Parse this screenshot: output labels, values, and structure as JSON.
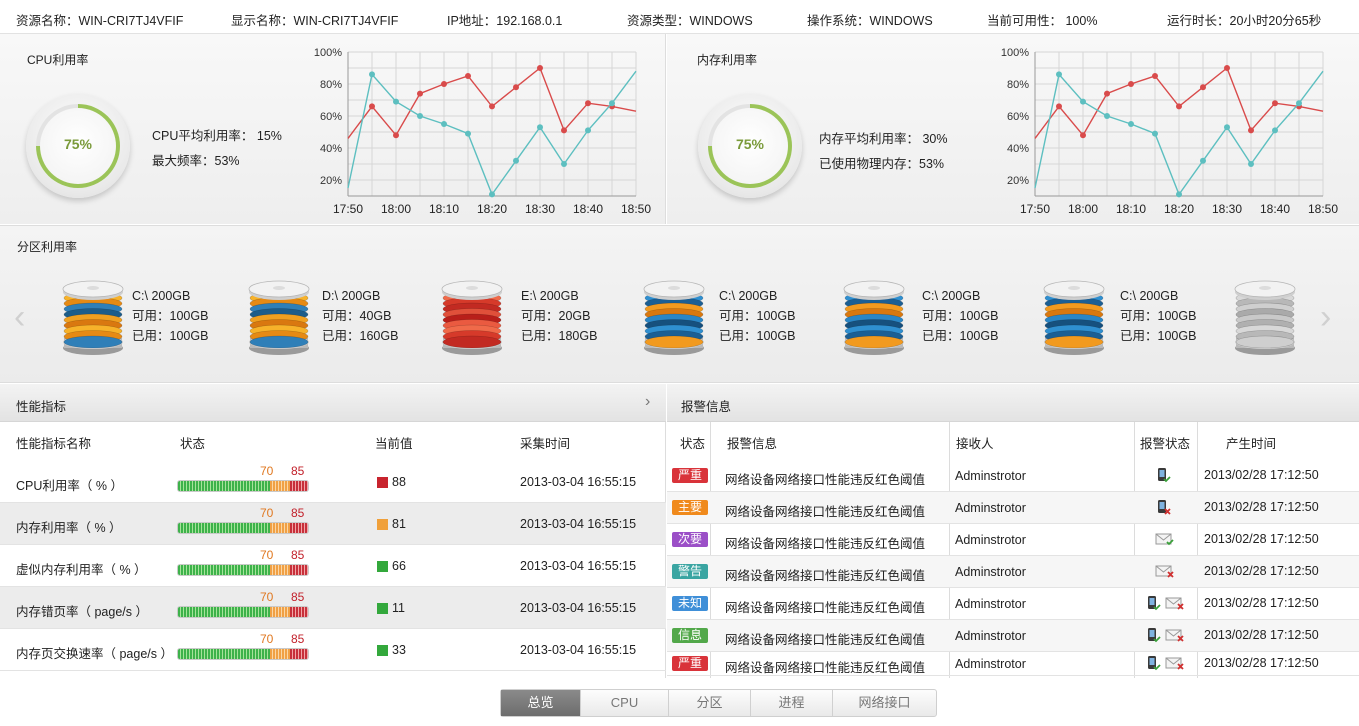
{
  "info": {
    "resource_name": "资源名称：WIN-CRI7TJ4VFIF",
    "display_name": "显示名称：WIN-CRI7TJ4VFIF",
    "ip": "IP地址：192.168.0.1",
    "resource_type": "资源类型：WINDOWS",
    "os": "操作系统：WINDOWS",
    "availability": "当前可用性： 100%",
    "uptime": "运行时长：20小时20分65秒"
  },
  "cpu": {
    "title": "CPU利用率",
    "gauge_value": "75%",
    "gauge_fraction": 0.75,
    "avg": "CPU平均利用率： 15%",
    "max_freq": "最大频率：53%"
  },
  "memory": {
    "title": "内存利用率",
    "gauge_value": "75%",
    "gauge_fraction": 0.75,
    "avg": "内存平均利用率： 30%",
    "physical": "已使用物理内存：53%"
  },
  "chart_data": [
    {
      "type": "line",
      "x": [
        "17:50",
        "17:55",
        "18:00",
        "18:05",
        "18:10",
        "18:15",
        "18:20",
        "18:25",
        "18:30",
        "18:35",
        "18:40",
        "18:45",
        "18:50"
      ],
      "x_ticks": [
        "17:50",
        "18:00",
        "18:10",
        "18:20",
        "18:30",
        "18:40",
        "18:50"
      ],
      "y_ticks": [
        "100%",
        "80%",
        "60%",
        "40%",
        "20%"
      ],
      "ylim": [
        10,
        100
      ],
      "grid": true,
      "series": [
        {
          "color": "#d94b4b",
          "values": [
            46,
            66,
            48,
            74,
            80,
            85,
            66,
            78,
            90,
            51,
            68,
            66,
            63
          ]
        },
        {
          "color": "#5dbfc0",
          "values": [
            15,
            86,
            69,
            60,
            55,
            49,
            11,
            32,
            53,
            30,
            51,
            68,
            88
          ]
        }
      ]
    },
    {
      "type": "line",
      "x": [
        "17:50",
        "17:55",
        "18:00",
        "18:05",
        "18:10",
        "18:15",
        "18:20",
        "18:25",
        "18:30",
        "18:35",
        "18:40",
        "18:45",
        "18:50"
      ],
      "x_ticks": [
        "17:50",
        "18:00",
        "18:10",
        "18:20",
        "18:30",
        "18:40",
        "18:50"
      ],
      "y_ticks": [
        "100%",
        "80%",
        "60%",
        "40%",
        "20%"
      ],
      "ylim": [
        10,
        100
      ],
      "grid": true,
      "series": [
        {
          "color": "#d94b4b",
          "values": [
            46,
            66,
            48,
            74,
            80,
            85,
            66,
            78,
            90,
            51,
            68,
            66,
            63
          ]
        },
        {
          "color": "#5dbfc0",
          "values": [
            15,
            86,
            69,
            60,
            55,
            49,
            11,
            32,
            53,
            30,
            51,
            68,
            88
          ]
        }
      ]
    }
  ],
  "partitions": {
    "title": "分区利用率",
    "items": [
      {
        "name": "C:\\ 200GB",
        "free": "可用：100GB",
        "used": "已用：100GB",
        "palette": "orange"
      },
      {
        "name": "D:\\ 200GB",
        "free": "可用：40GB",
        "used": "已用：160GB",
        "palette": "orange"
      },
      {
        "name": "E:\\ 200GB",
        "free": "可用：20GB",
        "used": "已用：180GB",
        "palette": "red"
      },
      {
        "name": "C:\\ 200GB",
        "free": "可用：100GB",
        "used": "已用：100GB",
        "palette": "blue"
      },
      {
        "name": "C:\\ 200GB",
        "free": "可用：100GB",
        "used": "已用：100GB",
        "palette": "blue"
      },
      {
        "name": "C:\\ 200GB",
        "free": "可用：100GB",
        "used": "已用：100GB",
        "palette": "blue"
      }
    ]
  },
  "perf": {
    "title": "性能指标",
    "headers": {
      "name": "性能指标名称",
      "status": "状态",
      "value": "当前值",
      "time": "采集时间"
    },
    "rows": [
      {
        "name": "CPU利用率（ % ）",
        "low": "70",
        "high": "85",
        "value": "88",
        "level": "red",
        "time": "2013-03-04 16:55:15"
      },
      {
        "name": "内存利用率（ % ）",
        "low": "70",
        "high": "85",
        "value": "81",
        "level": "orange",
        "time": "2013-03-04 16:55:15"
      },
      {
        "name": "虚似内存利用率（ % ）",
        "low": "70",
        "high": "85",
        "value": "66",
        "level": "green",
        "time": "2013-03-04 16:55:15"
      },
      {
        "name": "内存错页率（ page/s ）",
        "low": "70",
        "high": "85",
        "value": "11",
        "level": "green",
        "time": "2013-03-04 16:55:15"
      },
      {
        "name": "内存页交换速率（ page/s ）",
        "low": "70",
        "high": "85",
        "value": "33",
        "level": "green",
        "time": "2013-03-04 16:55:15"
      }
    ]
  },
  "alarm": {
    "title": "报警信息",
    "headers": {
      "status": "状态",
      "info": "报警信息",
      "receiver": "接收人",
      "alarm_status": "报警状态",
      "time": "产生时间"
    },
    "rows": [
      {
        "tag": "严重",
        "color": "#d9333a",
        "info": "网络设备网络接口性能违反红色阈值",
        "receiver": "Adminstrotor",
        "icons": [
          "phone-ok-icon"
        ],
        "time": "2013/02/28 17:12:50"
      },
      {
        "tag": "主要",
        "color": "#f08a1c",
        "info": "网络设备网络接口性能违反红色阈值",
        "receiver": "Adminstrotor",
        "icons": [
          "phone-fail-icon"
        ],
        "time": "2013/02/28 17:12:50"
      },
      {
        "tag": "次要",
        "color": "#9b4fc7",
        "info": "网络设备网络接口性能违反红色阈值",
        "receiver": "Adminstrotor",
        "icons": [
          "mail-ok-icon"
        ],
        "time": "2013/02/28 17:12:50"
      },
      {
        "tag": "警告",
        "color": "#3aa5a2",
        "info": "网络设备网络接口性能违反红色阈值",
        "receiver": "Adminstrotor",
        "icons": [
          "mail-fail-icon"
        ],
        "time": "2013/02/28 17:12:50"
      },
      {
        "tag": "未知",
        "color": "#3f8fd8",
        "info": "网络设备网络接口性能违反红色阈值",
        "receiver": "Adminstrotor",
        "icons": [
          "phone-ok-icon",
          "mail-fail-icon"
        ],
        "time": "2013/02/28 17:12:50"
      },
      {
        "tag": "信息",
        "color": "#52a84a",
        "info": "网络设备网络接口性能违反红色阈值",
        "receiver": "Adminstrotor",
        "icons": [
          "phone-ok-icon",
          "mail-fail-icon"
        ],
        "time": "2013/02/28 17:12:50"
      },
      {
        "tag": "严重",
        "color": "#d9333a",
        "info": "网络设备网络接口性能违反红色阈值",
        "receiver": "Adminstrotor",
        "icons": [
          "phone-ok-icon",
          "mail-fail-icon"
        ],
        "time": "2013/02/28 17:12:50"
      }
    ]
  },
  "tabs": [
    {
      "label": "总览",
      "active": true
    },
    {
      "label": "CPU",
      "active": false
    },
    {
      "label": "分区",
      "active": false
    },
    {
      "label": "进程",
      "active": false
    },
    {
      "label": "网络接口",
      "active": false
    }
  ]
}
